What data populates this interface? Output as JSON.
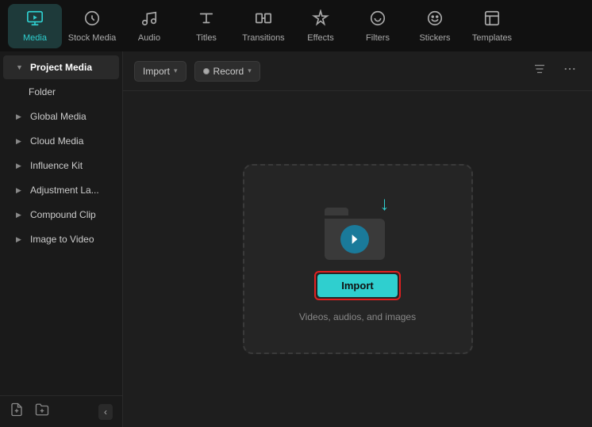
{
  "topNav": {
    "items": [
      {
        "id": "media",
        "label": "Media",
        "icon": "media",
        "active": true
      },
      {
        "id": "stock-media",
        "label": "Stock Media",
        "icon": "stock"
      },
      {
        "id": "audio",
        "label": "Audio",
        "icon": "audio"
      },
      {
        "id": "titles",
        "label": "Titles",
        "icon": "titles"
      },
      {
        "id": "transitions",
        "label": "Transitions",
        "icon": "transitions"
      },
      {
        "id": "effects",
        "label": "Effects",
        "icon": "effects"
      },
      {
        "id": "filters",
        "label": "Filters",
        "icon": "filters"
      },
      {
        "id": "stickers",
        "label": "Stickers",
        "icon": "stickers"
      },
      {
        "id": "templates",
        "label": "Templates",
        "icon": "templates"
      }
    ]
  },
  "sidebar": {
    "headerItem": {
      "label": "Project Media",
      "active": true
    },
    "items": [
      {
        "id": "folder",
        "label": "Folder",
        "hasChevron": false
      },
      {
        "id": "global-media",
        "label": "Global Media",
        "hasChevron": true
      },
      {
        "id": "cloud-media",
        "label": "Cloud Media",
        "hasChevron": true
      },
      {
        "id": "influence-kit",
        "label": "Influence Kit",
        "hasChevron": true
      },
      {
        "id": "adjustment-la",
        "label": "Adjustment La...",
        "hasChevron": true
      },
      {
        "id": "compound-clip",
        "label": "Compound Clip",
        "hasChevron": true
      },
      {
        "id": "image-to-video",
        "label": "Image to Video",
        "hasChevron": true
      }
    ],
    "footerIcons": [
      "new-file-icon",
      "new-folder-icon"
    ],
    "collapseLabel": "‹"
  },
  "toolbar": {
    "importLabel": "Import",
    "importCaret": "▾",
    "recordDot": "●",
    "recordLabel": "Record",
    "recordCaret": "▾",
    "filterIcon": "⚙",
    "moreIcon": "⋯"
  },
  "importArea": {
    "buttonLabel": "Import",
    "subtext": "Videos, audios, and images"
  }
}
